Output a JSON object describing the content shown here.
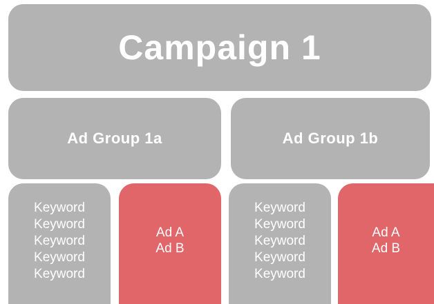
{
  "campaign": {
    "label": "Campaign 1"
  },
  "ad_groups": [
    {
      "label": "Ad Group 1a",
      "keywords": [
        "Keyword",
        "Keyword",
        "Keyword",
        "Keyword",
        "Keyword"
      ],
      "ads": [
        "Ad A",
        "Ad B"
      ]
    },
    {
      "label": "Ad Group 1b",
      "keywords": [
        "Keyword",
        "Keyword",
        "Keyword",
        "Keyword",
        "Keyword"
      ],
      "ads": [
        "Ad A",
        "Ad B"
      ]
    }
  ],
  "colors": {
    "gray_box": "#b3b3b3",
    "ad_box": "#e0666a",
    "text": "#ffffff"
  }
}
